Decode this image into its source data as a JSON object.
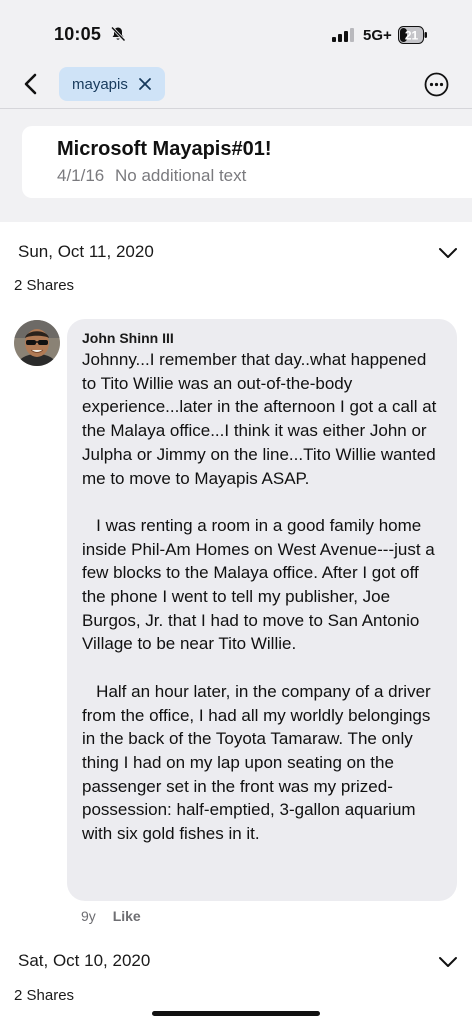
{
  "status": {
    "time": "10:05",
    "network": "5G+",
    "battery": "21",
    "icons": [
      "bell-slash-icon",
      "signal-icon",
      "battery-icon"
    ]
  },
  "topbar": {
    "filter_chip": "mayapis",
    "icons": [
      "chevron-left-icon",
      "close-icon",
      "more-options-icon"
    ]
  },
  "album_card": {
    "title": "Microsoft Mayapis#01!",
    "date": "4/1/16",
    "subtitle": "No additional text"
  },
  "feed": {
    "sections": [
      {
        "date": "Sun, Oct 11, 2020",
        "shares": "2 Shares",
        "comment": {
          "author": "John Shinn III",
          "paragraphs": [
            "Johnny...I remember that day..what happened to Tito Willie was an out-of-the-body experience...later in the afternoon I got a call at the Malaya office...I think it was either John or Julpha or Jimmy on the line...Tito Willie wanted me to move to Mayapis ASAP.",
            "   I was renting a room in a good family home inside Phil-Am Homes on West Avenue---just a few blocks to the Malaya office. After I got off the phone I went to tell my publisher, Joe Burgos, Jr. that I had to move to San Antonio Village to be near Tito Willie.",
            "   Half an hour later, in the company of a driver from the office, I had all my worldly belongings in the back of the Toyota Tamaraw. The only thing I had on my lap upon seating on the passenger set in the front was my prized-possession: half-emptied, 3-gallon aquarium with six gold fishes in it."
          ],
          "age": "9y",
          "like_label": "Like"
        }
      },
      {
        "date": "Sat, Oct 10, 2020",
        "shares": "2 Shares"
      }
    ]
  },
  "colors": {
    "chip_bg": "#cfe3f7",
    "bubble_bg": "#ececf0",
    "page_bg": "#f1f1f3"
  }
}
